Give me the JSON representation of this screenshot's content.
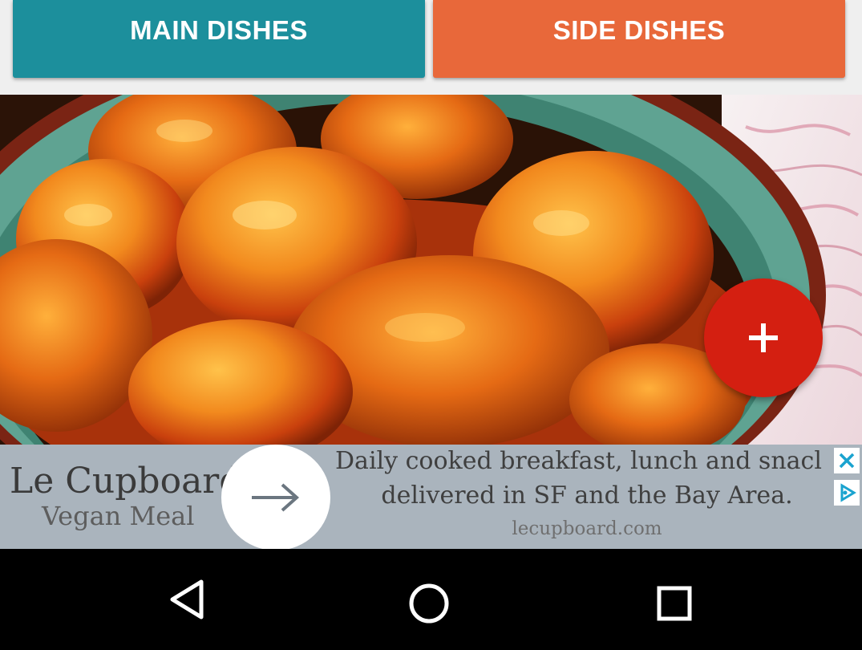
{
  "tabs": {
    "main_label": "MAIN DISHES",
    "side_label": "SIDE DISHES",
    "main_color": "#1c8f9c",
    "side_color": "#e8683a"
  },
  "photo": {
    "subject": "fried dumplings in orange sauce in a teal bowl"
  },
  "fab": {
    "icon": "plus-icon",
    "color": "#d41f11"
  },
  "ad": {
    "brand": "Le Cupboard",
    "subtitle": "Vegan Meal",
    "headline_line1": "Daily cooked breakfast, lunch and snacl",
    "headline_line2": "delivered in SF and the Bay Area.",
    "url": "lecupboard.com",
    "arrow_icon": "arrow-right-icon",
    "close_icon": "close-icon",
    "choices_icon": "adchoices-icon"
  },
  "nav": {
    "back_icon": "back-triangle-icon",
    "home_icon": "home-circle-icon",
    "recents_icon": "recents-square-icon"
  }
}
